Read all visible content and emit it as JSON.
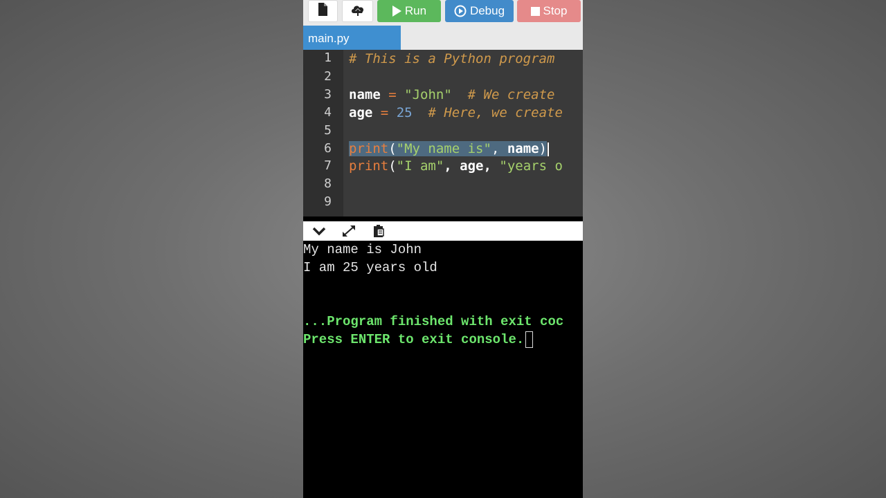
{
  "toolbar": {
    "new_file_icon": "file-icon",
    "upload_icon": "cloud-upload-icon",
    "run_label": "Run",
    "debug_label": "Debug",
    "stop_label": "Stop"
  },
  "tabs": [
    {
      "label": "main.py",
      "active": true
    }
  ],
  "editor": {
    "line_numbers": [
      "1",
      "2",
      "3",
      "4",
      "5",
      "6",
      "7",
      "8",
      "9"
    ],
    "lines": [
      {
        "comment": "# This is a Python program"
      },
      {},
      {
        "var": "name",
        "op": "=",
        "str": "\"John\"",
        "comment": "# We create"
      },
      {
        "var": "age",
        "op": "=",
        "num": "25",
        "comment": "# Here, we create"
      },
      {},
      {
        "fn": "print",
        "open": "(",
        "str": "\"My name is\"",
        "sep": ",",
        "arg": " name",
        "close": ")"
      },
      {
        "fn": "print",
        "open": "(",
        "str1": "\"I am\"",
        "mid": ", age, ",
        "str2": "\"years o"
      },
      {},
      {}
    ]
  },
  "console_toolbar": {
    "collapse_icon": "chevron-down-icon",
    "expand_icon": "expand-icon",
    "copy_icon": "clipboard-icon"
  },
  "console": {
    "output": [
      "My name is John",
      "I am 25 years old"
    ],
    "finish_line": "...Program finished with exit coc",
    "prompt_line": "Press ENTER to exit console."
  },
  "colors": {
    "run": "#5cb85c",
    "debug": "#428bca",
    "stop": "#e58a8a",
    "tab": "#3f8fd0",
    "console_green": "#6de66d"
  }
}
